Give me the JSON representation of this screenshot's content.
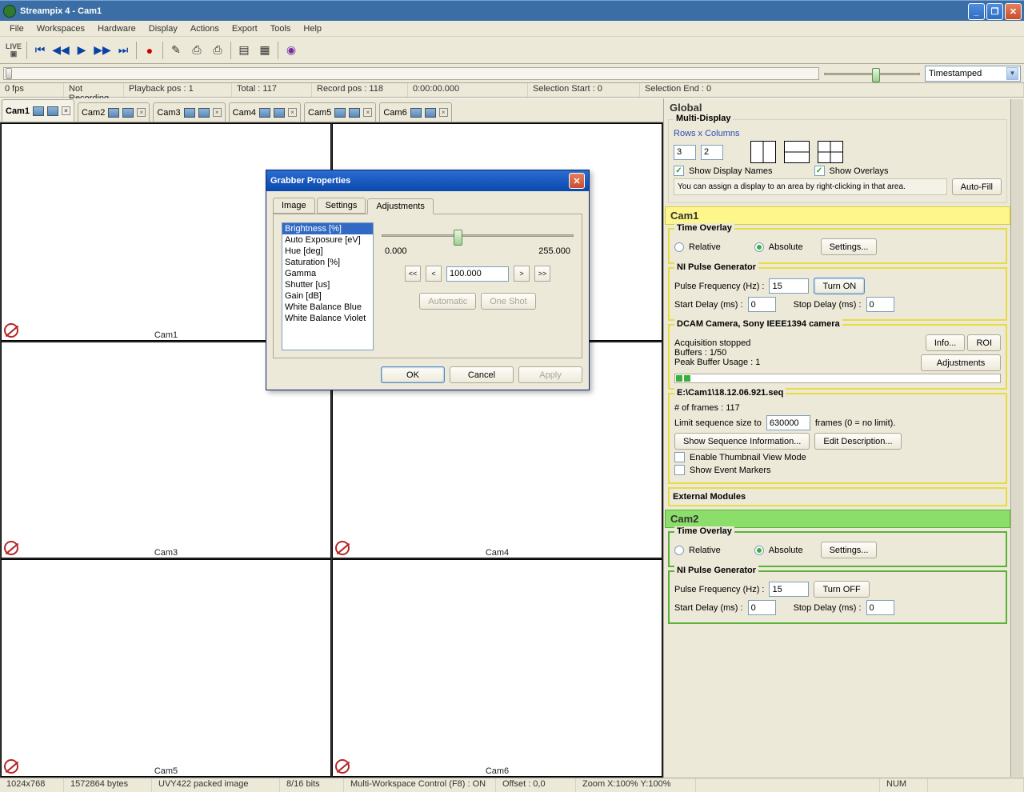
{
  "title": "Streampix 4 - Cam1",
  "menu": [
    "File",
    "Workspaces",
    "Hardware",
    "Display",
    "Actions",
    "Export",
    "Tools",
    "Help"
  ],
  "timestamp_mode": "Timestamped",
  "status_top": {
    "fps": "0 fps",
    "rec": "Not Recording",
    "playback": "Playback pos : 1",
    "total": "Total : 117",
    "recpos": "Record pos : 118",
    "time": "0:00:00.000",
    "selstart": "Selection Start : 0",
    "selend": "Selection End : 0"
  },
  "camtabs": [
    "Cam1",
    "Cam2",
    "Cam3",
    "Cam4",
    "Cam5",
    "Cam6"
  ],
  "gridlabels": [
    "Cam1",
    "",
    "Cam3",
    "Cam4",
    "Cam5",
    "Cam6"
  ],
  "dialog": {
    "title": "Grabber Properties",
    "tabs": [
      "Image",
      "Settings",
      "Adjustments"
    ],
    "items": [
      "Brightness [%]",
      "Auto Exposure [eV]",
      "Hue [deg]",
      "Saturation [%]",
      "Gamma",
      "Shutter [us]",
      "Gain [dB]",
      "White Balance Blue",
      "White Balance Violet"
    ],
    "min": "0.000",
    "max": "255.000",
    "value": "100.000",
    "automatic": "Automatic",
    "oneshot": "One Shot",
    "ok": "OK",
    "cancel": "Cancel",
    "apply": "Apply"
  },
  "global": {
    "title": "Global",
    "multidisplay": "Multi-Display",
    "rowscols": "Rows x Columns",
    "rows": "3",
    "cols": "2",
    "showdisp": "Show Display Names",
    "showover": "Show Overlays",
    "hint": "You can assign a display to an area by right-clicking in that area.",
    "autofill": "Auto-Fill"
  },
  "cam1": {
    "title": "Cam1",
    "timeoverlay": "Time Overlay",
    "relative": "Relative",
    "absolute": "Absolute",
    "settings": "Settings...",
    "ni": "NI Pulse Generator",
    "pfreq_l": "Pulse Frequency (Hz) :",
    "pfreq_v": "15",
    "turn": "Turn ON",
    "sdelay_l": "Start Delay (ms) :",
    "sdelay_v": "0",
    "edelay_l": "Stop Delay (ms) :",
    "edelay_v": "0",
    "dcam": "DCAM Camera, Sony IEEE1394 camera",
    "acq": "Acquisition stopped",
    "buffers": "Buffers : 1/50",
    "peak": "Peak Buffer Usage : 1",
    "info": "Info...",
    "roi": "ROI",
    "adjustments": "Adjustments",
    "seqpath": "E:\\Cam1\\18.12.06.921.seq",
    "nframes": "# of frames : 117",
    "limit_l": "Limit sequence size to",
    "limit_v": "630000",
    "limit_t": "frames (0 = no limit).",
    "showseq": "Show Sequence Information...",
    "editdesc": "Edit Description...",
    "enablethumb": "Enable Thumbnail View Mode",
    "showmarkers": "Show Event Markers",
    "ext": "External Modules"
  },
  "cam2": {
    "title": "Cam2",
    "turn": "Turn OFF"
  },
  "status_bottom": {
    "res": "1024x768",
    "bytes": "1572864 bytes",
    "format": "UVY422 packed image",
    "bits": "8/16 bits",
    "mwc": "Multi-Workspace Control (F8) : ON",
    "offset": "Offset : 0,0",
    "zoom": "Zoom X:100%  Y:100%",
    "num": "NUM"
  }
}
